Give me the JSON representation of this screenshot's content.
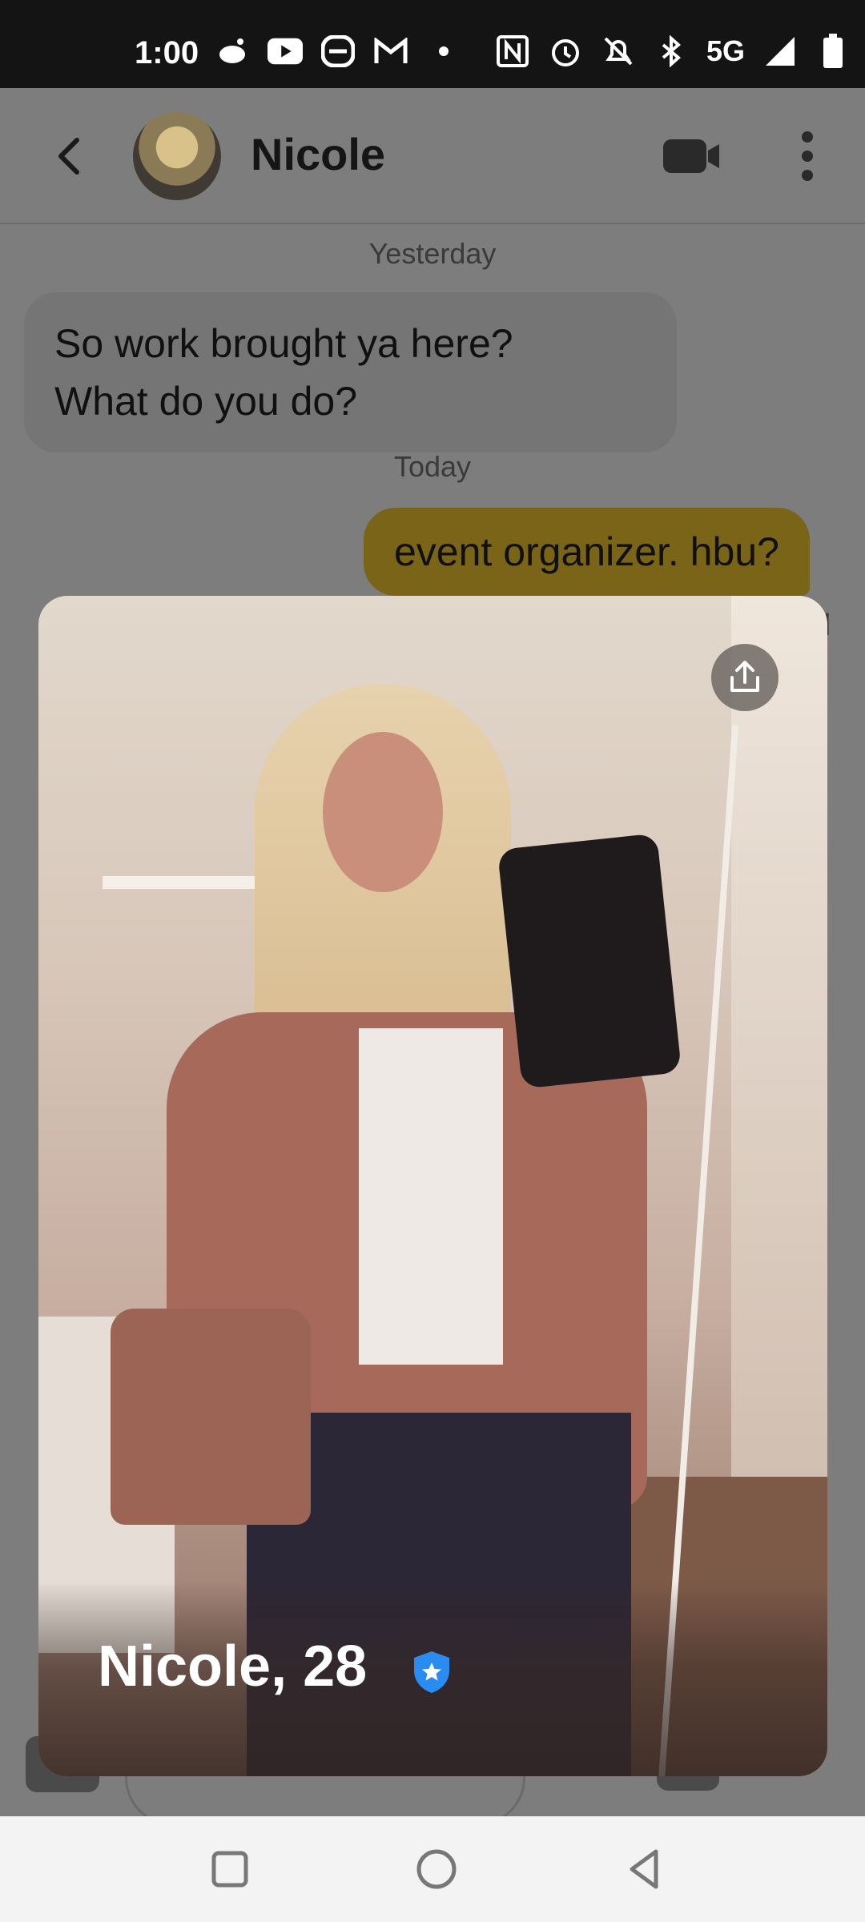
{
  "status_bar": {
    "time": "1:00",
    "network": "5G",
    "left_icons": [
      "reddit-icon",
      "youtube-icon",
      "app-icon",
      "gmail-icon",
      "dot-icon"
    ],
    "right_icons": [
      "nfc-icon",
      "alarm-icon",
      "mute-icon",
      "bluetooth-icon"
    ]
  },
  "header": {
    "contact_name": "Nicole"
  },
  "messages": {
    "divider_yesterday": "Yesterday",
    "incoming_line1": "So work brought ya here?",
    "incoming_line2": "What do you do?",
    "divider_today": "Today",
    "outgoing": "event organizer. hbu?",
    "read_fragment": "d"
  },
  "profile_card": {
    "name_age": "Nicole, 28",
    "verified": true
  },
  "colors": {
    "outgoing_bubble": "#7a6418",
    "verified_blue": "#2a8cf0",
    "overlay_gray": "#7d7d7d"
  }
}
